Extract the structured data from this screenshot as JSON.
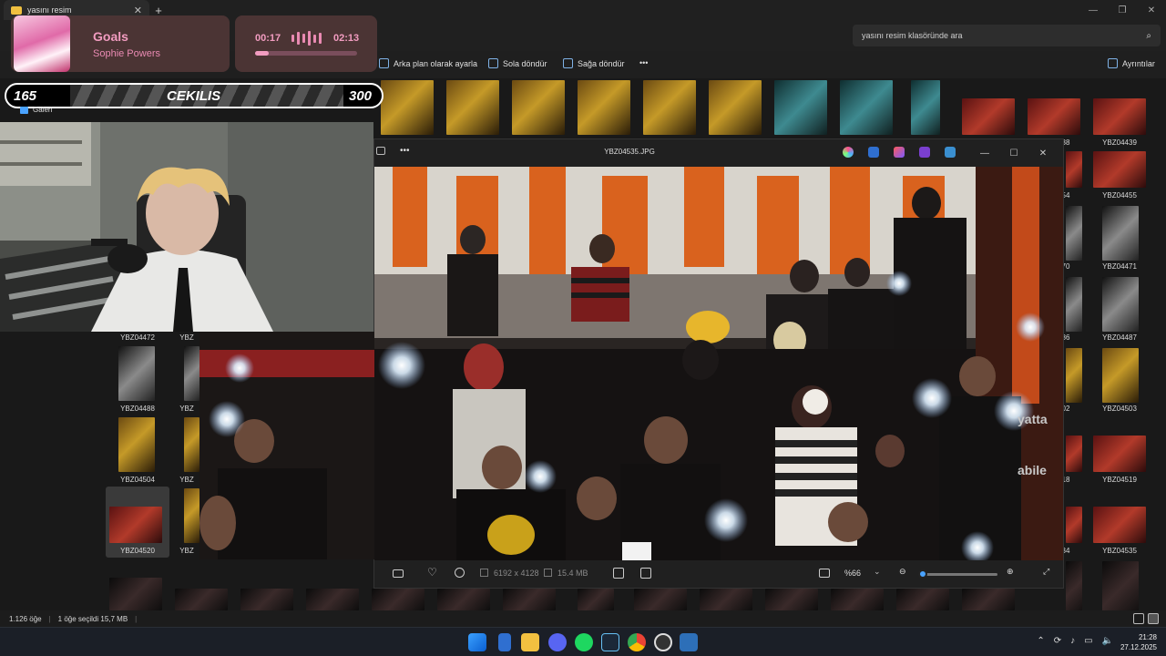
{
  "explorer": {
    "tab_title": "yasını resim",
    "search_placeholder": "yasını resim klasöründe ara",
    "commands": [
      "Arka plan olarak ayarla",
      "Sola döndür",
      "Sağa döndür"
    ],
    "more": "•••",
    "details": "Ayrıntılar",
    "nav_item": "Galeri",
    "thumb_labels": {
      "r1_right": "YBZ04439",
      "right_col": [
        "YBZ04455",
        "YBZ04471",
        "YBZ04487",
        "YBZ04503",
        "YBZ04519",
        "YBZ04535"
      ],
      "right_partial": [
        "38",
        "54",
        "70",
        "86",
        "02",
        "18",
        "34"
      ],
      "left_col": [
        "YBZ04472",
        "YBZ04488",
        "YBZ04504",
        "YBZ04520"
      ],
      "left_partial": [
        "YBZ",
        "YBZ",
        "YBZ",
        "YBZ"
      ]
    },
    "status": {
      "count": "1.126 öğe",
      "selected": "1 öğe seçildi  15,7 MB"
    }
  },
  "viewer": {
    "file_name": "YBZ04535.JPG",
    "dimensions": "6192 x 4128",
    "file_size": "15.4 MB",
    "zoom": "%66",
    "zoom_fraction": 0.05,
    "more": "•••"
  },
  "music": {
    "title": "Goals",
    "artist": "Sophie Powers",
    "elapsed": "00:17",
    "total": "02:13",
    "progress": 0.13
  },
  "cekilis": {
    "left": "165",
    "label": "CEKILIS",
    "right": "300"
  },
  "clock": {
    "time": "21:28",
    "date": "27.12.2025"
  },
  "colors": {
    "overlay_bg": "#4b3434",
    "overlay_accent": "#f29cc0",
    "accent_blue": "#4aa3ff"
  }
}
